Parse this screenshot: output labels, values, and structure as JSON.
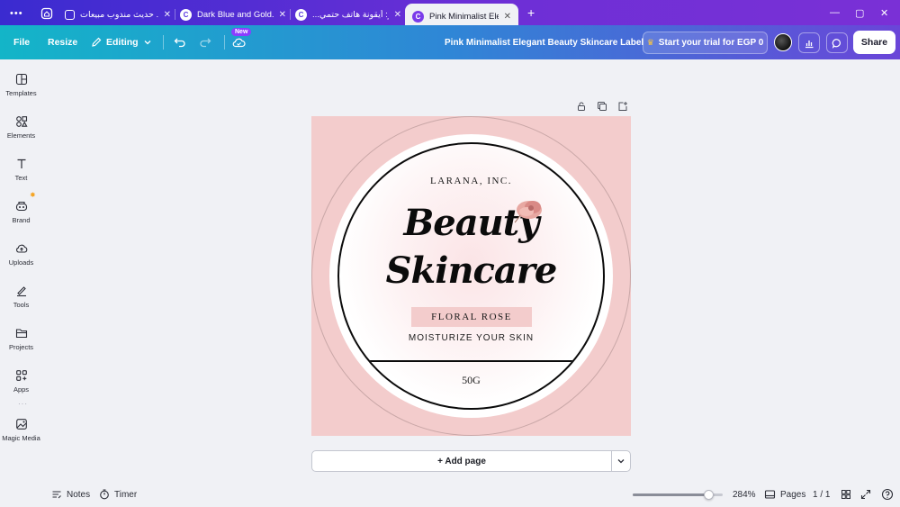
{
  "browser": {
    "tabs": [
      {
        "label": "حديث مندوب مبيعات ..."
      },
      {
        "label": "Dark Blue and Gold..."
      },
      {
        "label": "...ور: أيقونة هاتف حتمي"
      },
      {
        "label": "Pink Minimalist Ele..."
      }
    ],
    "new_tab": "+",
    "window_controls": [
      "—",
      "▢",
      "✕"
    ]
  },
  "toolbar": {
    "file": "File",
    "resize": "Resize",
    "editing": "Editing",
    "new_badge": "New",
    "design_title": "Pink Minimalist Elegant Beauty Skincare Label",
    "trial": "Start your trial for EGP 0",
    "share": "Share"
  },
  "sidebar": {
    "items": [
      {
        "label": "Templates"
      },
      {
        "label": "Elements"
      },
      {
        "label": "Text"
      },
      {
        "label": "Brand"
      },
      {
        "label": "Uploads"
      },
      {
        "label": "Tools"
      },
      {
        "label": "Projects"
      },
      {
        "label": "Apps"
      },
      {
        "label": "Magic Media"
      }
    ]
  },
  "design": {
    "company": "LARANA, INC.",
    "title_line1": "Beauty",
    "title_line2": "Skincare",
    "variant": "FLORAL ROSE",
    "tagline": "MOISTURIZE YOUR SKIN",
    "weight": "50G",
    "colors": {
      "background": "#f3cccc",
      "ring": "#0b0b0b",
      "accent_bar": "#f3cccc"
    }
  },
  "canvas_actions": {
    "add_page": "+ Add page"
  },
  "footer": {
    "notes": "Notes",
    "timer": "Timer",
    "zoom": "284%",
    "zoom_level": 0.84,
    "pages": "Pages",
    "page_count": "1 / 1"
  }
}
